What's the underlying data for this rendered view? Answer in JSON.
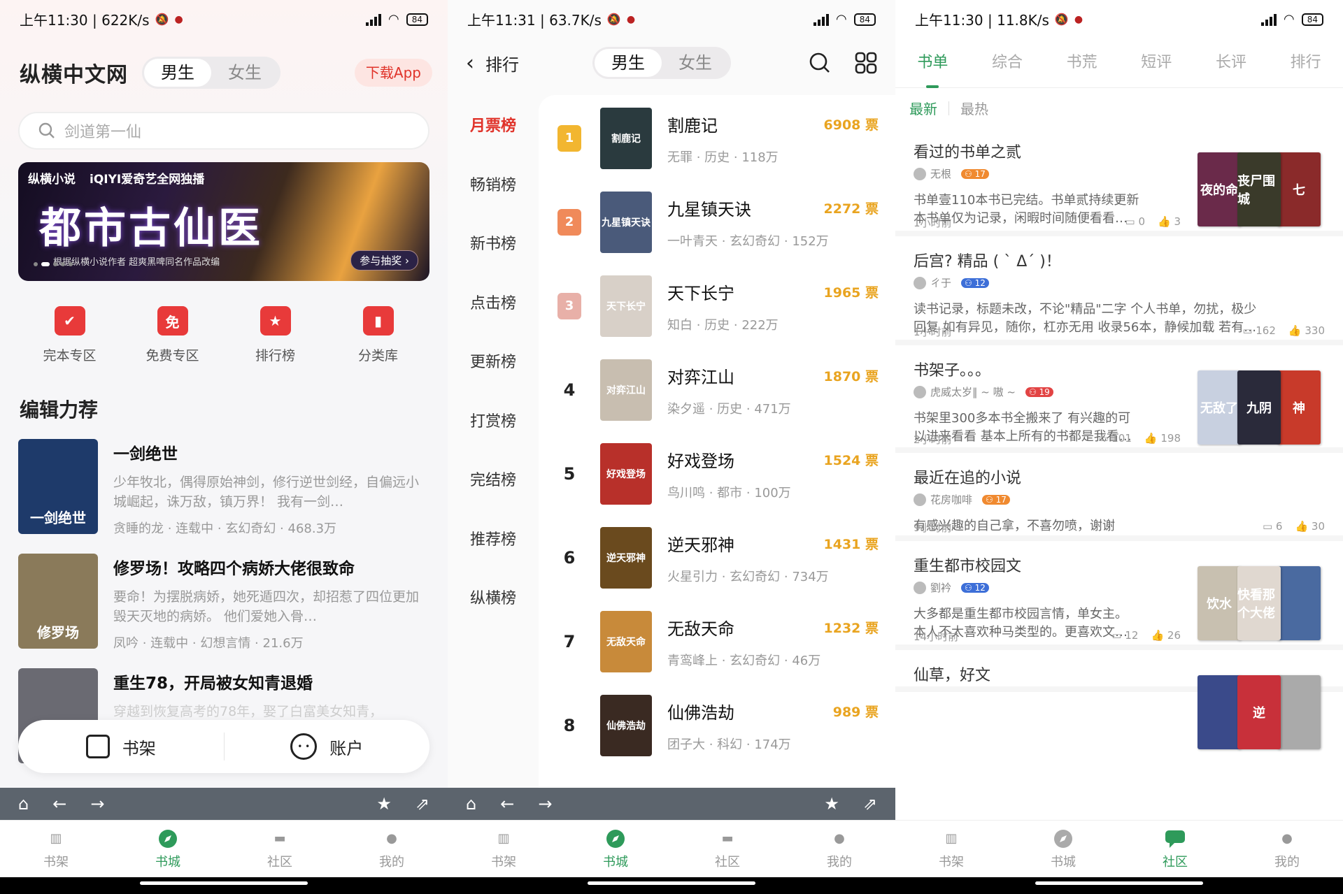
{
  "status": [
    {
      "time": "上午11:30 | 622K/s",
      "battery": "84"
    },
    {
      "time": "上午11:31 | 63.7K/s",
      "battery": "84"
    },
    {
      "time": "上午11:30 | 11.8K/s",
      "battery": "84"
    }
  ],
  "bottom_nav": [
    "书架",
    "书城",
    "社区",
    "我的"
  ],
  "panel1": {
    "logo": "纵横中文网",
    "gender": [
      "男生",
      "女生"
    ],
    "download": "下载App",
    "search_placeholder": "剑道第一仙",
    "banner": {
      "brand": "纵横小说",
      "partner": "iQIYI爱奇艺全网独播",
      "title": "都市古仙医",
      "subtitle": "根据纵横小说作者 超爽黑啤同名作品改编",
      "join": "参与抽奖 ›"
    },
    "categories": [
      {
        "label": "完本专区",
        "icon": "✔"
      },
      {
        "label": "免费专区",
        "icon": "免"
      },
      {
        "label": "排行榜",
        "icon": "★"
      },
      {
        "label": "分类库",
        "icon": "▮"
      }
    ],
    "section_title": "编辑力荐",
    "recommendations": [
      {
        "title": "一剑绝世",
        "desc": "少年牧北，偶得原始神剑，修行逆世剑经，自偏远小城崛起，诛万敌，镇万界！ 我有一剑…",
        "meta": "贪睡的龙 · 连载中 · 玄幻奇幻 · 468.3万",
        "cover_text": "一剑绝世",
        "cover_color": "#1e3a6a"
      },
      {
        "title": "修罗场！攻略四个病娇大佬很致命",
        "desc": "要命！为摆脱病娇，她死遁四次，却招惹了四位更加毁天灭地的病娇。 他们爱她入骨…",
        "meta": "凤吟 · 连载中 · 幻想言情 · 21.6万",
        "cover_text": "修罗场",
        "cover_color": "#8a7a5a"
      },
      {
        "title": "重生78，开局被女知青退婚",
        "desc": "穿越到恢复高考的78年，娶了白富美女知青，",
        "meta": "",
        "cover_text": "",
        "cover_color": "#6a6a72"
      }
    ],
    "shelf": "书架",
    "account": "账户"
  },
  "panel2": {
    "title": "排行",
    "gender": [
      "男生",
      "女生"
    ],
    "sidebar": [
      "月票榜",
      "畅销榜",
      "新书榜",
      "点击榜",
      "更新榜",
      "打赏榜",
      "完结榜",
      "推荐榜",
      "纵横榜"
    ],
    "rankings": [
      {
        "rank": "1",
        "name": "割鹿记",
        "votes": "6908 票",
        "meta": "无罪 · 历史 · 118万",
        "cover_text": "割鹿记",
        "cover_color": "#2a3a3e"
      },
      {
        "rank": "2",
        "name": "九星镇天诀",
        "votes": "2272 票",
        "meta": "一叶青天 · 玄幻奇幻 · 152万",
        "cover_text": "九星镇天诀",
        "cover_color": "#4a5a7a"
      },
      {
        "rank": "3",
        "name": "天下长宁",
        "votes": "1965 票",
        "meta": "知白 · 历史 · 222万",
        "cover_text": "天下长宁",
        "cover_color": "#d8d0c8"
      },
      {
        "rank": "4",
        "name": "对弈江山",
        "votes": "1870 票",
        "meta": "染夕遥 · 历史 · 471万",
        "cover_text": "对弈江山",
        "cover_color": "#c8beb0"
      },
      {
        "rank": "5",
        "name": "好戏登场",
        "votes": "1524 票",
        "meta": "鸟川鸣 · 都市 · 100万",
        "cover_text": "好戏登场",
        "cover_color": "#b8302a"
      },
      {
        "rank": "6",
        "name": "逆天邪神",
        "votes": "1431 票",
        "meta": "火星引力 · 玄幻奇幻 · 734万",
        "cover_text": "逆天邪神",
        "cover_color": "#6a4a1e"
      },
      {
        "rank": "7",
        "name": "无敌天命",
        "votes": "1232 票",
        "meta": "青鸾峰上 · 玄幻奇幻 · 46万",
        "cover_text": "无敌天命",
        "cover_color": "#c88a3a"
      },
      {
        "rank": "8",
        "name": "仙佛浩劫",
        "votes": "989 票",
        "meta": "团子大 · 科幻 · 174万",
        "cover_text": "仙佛浩劫",
        "cover_color": "#3a2a22"
      }
    ]
  },
  "panel3": {
    "tabs": [
      "书单",
      "综合",
      "书荒",
      "短评",
      "长评",
      "排行"
    ],
    "sub": [
      "最新",
      "最热"
    ],
    "posts": [
      {
        "title": "看过的书单之贰",
        "user": "无根",
        "level": "17",
        "lvcolor": "or",
        "body": [
          "书单壹110本书已完结。书单贰持续更新",
          "本书单仅为记录，闲暇时间随便看看…"
        ],
        "time": "1小时前",
        "comments": "0",
        "likes": "3",
        "covers": [
          {
            "t": "夜的命",
            "c": "#6a2a4a"
          },
          {
            "t": "丧尸围城",
            "c": "#3a3a2a"
          },
          {
            "t": "七",
            "c": "#8a2a2a"
          }
        ]
      },
      {
        "title": "后宫? 精品 ( ` Δ´ )！",
        "user": "ㄔ于",
        "level": "12",
        "lvcolor": "",
        "body": [
          "读书记录，标题未改，不论\"精品\"二字 个人书单，勿扰，极少",
          "回复 如有异见，随你，杠亦无用 收录56本，静候加载 若有…"
        ],
        "time": "1小时前",
        "comments": "162",
        "likes": "330",
        "covers": []
      },
      {
        "title": "书架子。。。",
        "user": "虎威太岁‖ ~ 嗷 ~",
        "level": "19",
        "lvcolor": "rd",
        "body": [
          "书架里300多本书全搬来了 有兴趣的可",
          "以进来看看 基本上所有的书都是我看…"
        ],
        "time": "2小时前",
        "comments": "101",
        "likes": "198",
        "covers": [
          {
            "t": "无敌了",
            "c": "#c8d0e0"
          },
          {
            "t": "九阴",
            "c": "#2a2a3a"
          },
          {
            "t": "神",
            "c": "#c83a2a"
          }
        ]
      },
      {
        "title": "最近在追的小说",
        "user": "花房咖啡",
        "level": "17",
        "lvcolor": "or",
        "body": [
          "有感兴趣的自己拿，不喜勿喷，谢谢"
        ],
        "time": "9小时前",
        "comments": "6",
        "likes": "30",
        "covers": []
      },
      {
        "title": "重生都市校园文",
        "user": "劉衿",
        "level": "12",
        "lvcolor": "",
        "body": [
          "大多都是重生都市校园言情，单女主。",
          "本人不太喜欢种马类型的。更喜欢文…"
        ],
        "time": "14小时前",
        "comments": "12",
        "likes": "26",
        "covers": [
          {
            "t": "饮水",
            "c": "#c8c0b0"
          },
          {
            "t": "快看那个大佬",
            "c": "#e0d8d0"
          },
          {
            "t": "",
            "c": "#4a6aa0"
          }
        ]
      },
      {
        "title": "仙草，好文",
        "user": "",
        "level": "",
        "lvcolor": "",
        "body": [],
        "time": "",
        "comments": "",
        "likes": "",
        "covers": [
          {
            "t": "",
            "c": "#3a4a8a"
          },
          {
            "t": "逆",
            "c": "#c8303a"
          },
          {
            "t": "",
            "c": "#aaa"
          }
        ]
      }
    ]
  }
}
